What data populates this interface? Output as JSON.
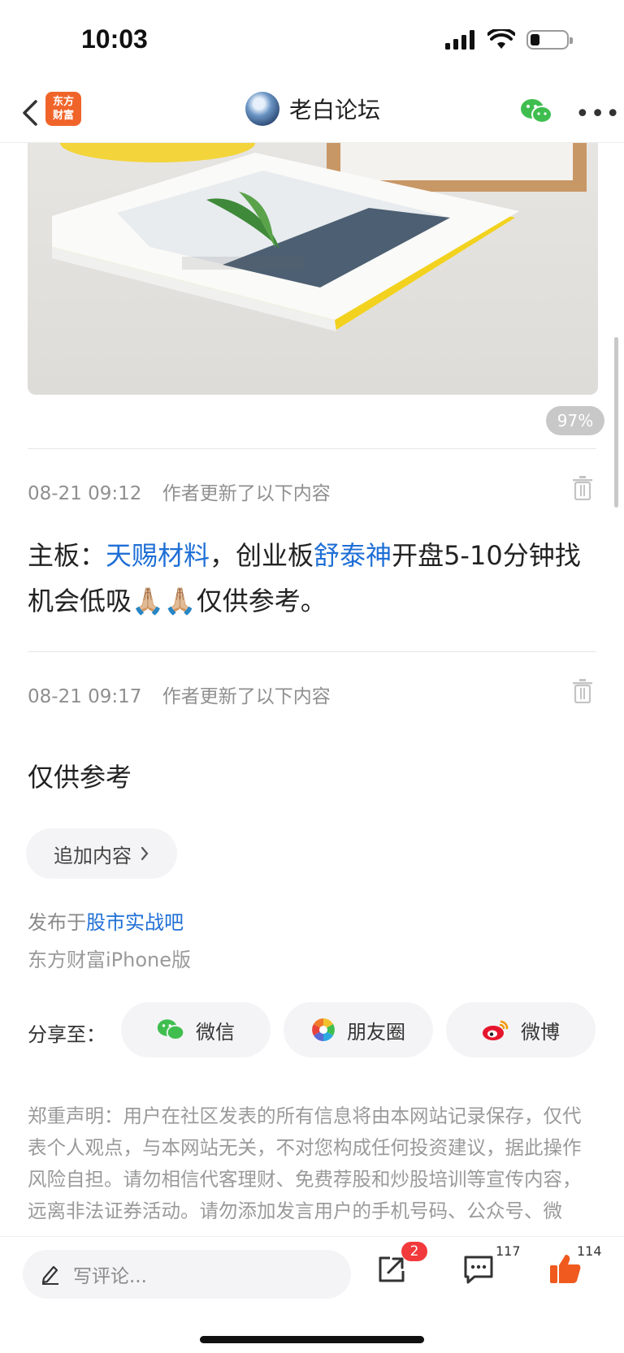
{
  "status": {
    "time": "10:03",
    "battery_level": 0.25
  },
  "nav": {
    "logo_text": [
      "东方",
      "财富"
    ],
    "title": "老白论坛"
  },
  "post": {
    "zoom_badge": "97%",
    "updates": [
      {
        "time": "08-21 09:12",
        "label": "作者更新了以下内容"
      },
      {
        "time": "08-21 09:17",
        "label": "作者更新了以下内容"
      }
    ],
    "content": {
      "part1": "主板：",
      "link1": "天赐材料",
      "part2": "，创业板",
      "link2": "舒泰神",
      "part3": "开盘5-10分钟找机会低吸",
      "emoji": "🙏🏼🙏🏼",
      "part4": "仅供参考。"
    },
    "second_text": "仅供参考",
    "append_label": "追加内容",
    "published_prefix": "发布于",
    "published_forum": "股市实战吧",
    "client": "东方财富iPhone版"
  },
  "share": {
    "label": "分享至：",
    "targets": [
      "微信",
      "朋友圈",
      "微博"
    ]
  },
  "disclaimer": "郑重声明：用户在社区发表的所有信息将由本网站记录保存，仅代表个人观点，与本网站无关，不对您构成任何投资建议，据此操作风险自担。请勿相信代客理财、免费荐股和炒股培训等宣传内容，远离非法证券活动。请勿添加发言用户的手机号码、公众号、微博、微信及QQ等信息，谨防上当受骗！",
  "bottom": {
    "comment_placeholder": "写评论...",
    "share_badge": "2",
    "comment_count": "117",
    "like_count": "114"
  },
  "colors": {
    "accent_link": "#1f6fd6",
    "brand_orange": "#f0642a",
    "like_orange": "#f05a1e",
    "badge_red": "#f2393b",
    "wechat_green": "#3fbe4f"
  }
}
